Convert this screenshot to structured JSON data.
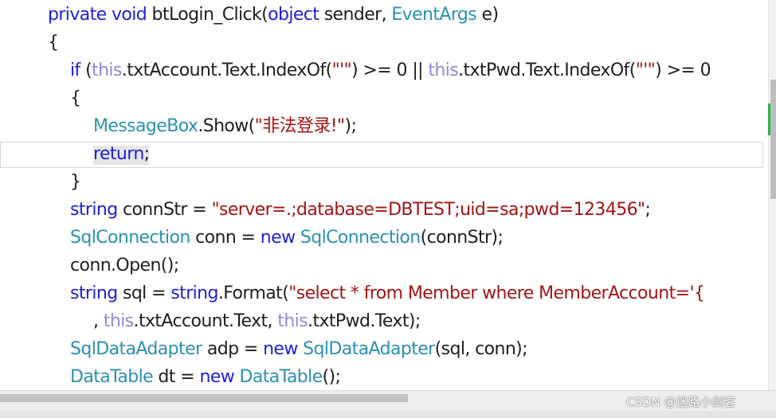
{
  "code_lines": [
    {
      "segments": [
        {
          "t": "private ",
          "c": "kw"
        },
        {
          "t": "void ",
          "c": "kw"
        },
        {
          "t": "btLogin_Click(",
          "c": "pln"
        },
        {
          "t": "object ",
          "c": "kw"
        },
        {
          "t": "sender, ",
          "c": "pln"
        },
        {
          "t": "EventArgs ",
          "c": "typ"
        },
        {
          "t": "e)",
          "c": "pln"
        }
      ]
    },
    {
      "segments": [
        {
          "t": "{",
          "c": "pln"
        }
      ]
    },
    {
      "segments": [
        {
          "t": "if ",
          "c": "kw"
        },
        {
          "t": "(",
          "c": "pln"
        },
        {
          "t": "this",
          "c": "ths"
        },
        {
          "t": ".txtAccount.Text.IndexOf(",
          "c": "pln"
        },
        {
          "t": "\"'\"",
          "c": "str"
        },
        {
          "t": ") >= 0 || ",
          "c": "pln"
        },
        {
          "t": "this",
          "c": "ths"
        },
        {
          "t": ".txtPwd.Text.IndexOf(",
          "c": "pln"
        },
        {
          "t": "\"'\"",
          "c": "str"
        },
        {
          "t": ") >= 0",
          "c": "pln"
        }
      ]
    },
    {
      "segments": [
        {
          "t": "{",
          "c": "pln"
        }
      ]
    },
    {
      "segments": [
        {
          "t": "MessageBox",
          "c": "typ"
        },
        {
          "t": ".Show(",
          "c": "pln"
        },
        {
          "t": "\"非法登录!\"",
          "c": "str"
        },
        {
          "t": ");",
          "c": "pln"
        }
      ]
    },
    {
      "segments": [
        {
          "t": "return",
          "c": "kw"
        },
        {
          "t": ";",
          "c": "pln"
        }
      ]
    },
    {
      "segments": [
        {
          "t": "}",
          "c": "pln"
        }
      ]
    },
    {
      "segments": [
        {
          "t": "string ",
          "c": "kw"
        },
        {
          "t": "connStr = ",
          "c": "pln"
        },
        {
          "t": "\"server=.;database=DBTEST;uid=sa;pwd=123456\"",
          "c": "str"
        },
        {
          "t": ";",
          "c": "pln"
        }
      ]
    },
    {
      "segments": [
        {
          "t": "SqlConnection ",
          "c": "typ"
        },
        {
          "t": "conn = ",
          "c": "pln"
        },
        {
          "t": "new ",
          "c": "kw"
        },
        {
          "t": "SqlConnection",
          "c": "typ"
        },
        {
          "t": "(connStr);",
          "c": "pln"
        }
      ]
    },
    {
      "segments": [
        {
          "t": "conn.Open();",
          "c": "pln"
        }
      ]
    },
    {
      "segments": [
        {
          "t": "string ",
          "c": "kw"
        },
        {
          "t": "sql = ",
          "c": "pln"
        },
        {
          "t": "string",
          "c": "kw"
        },
        {
          "t": ".Format(",
          "c": "pln"
        },
        {
          "t": "\"select * from Member where MemberAccount='{",
          "c": "str"
        }
      ]
    },
    {
      "segments": [
        {
          "t": ", ",
          "c": "pln"
        },
        {
          "t": "this",
          "c": "ths"
        },
        {
          "t": ".txtAccount.Text, ",
          "c": "pln"
        },
        {
          "t": "this",
          "c": "ths"
        },
        {
          "t": ".txtPwd.Text);",
          "c": "pln"
        }
      ]
    },
    {
      "segments": [
        {
          "t": "SqlDataAdapter ",
          "c": "typ"
        },
        {
          "t": "adp = ",
          "c": "pln"
        },
        {
          "t": "new ",
          "c": "kw"
        },
        {
          "t": "SqlDataAdapter",
          "c": "typ"
        },
        {
          "t": "(sql, conn);",
          "c": "pln"
        }
      ]
    },
    {
      "segments": [
        {
          "t": "DataTable ",
          "c": "typ"
        },
        {
          "t": "dt = ",
          "c": "pln"
        },
        {
          "t": "new ",
          "c": "kw"
        },
        {
          "t": "DataTable",
          "c": "typ"
        },
        {
          "t": "();",
          "c": "pln"
        }
      ]
    }
  ],
  "watermark": "CSDN @迷路小剑客",
  "colors": {
    "keyword": "#1f1fd6",
    "type": "#2b91af",
    "string": "#a31515",
    "this": "#8c8cd8",
    "text": "#1e1e1e",
    "change_marker": "#27b24a"
  }
}
